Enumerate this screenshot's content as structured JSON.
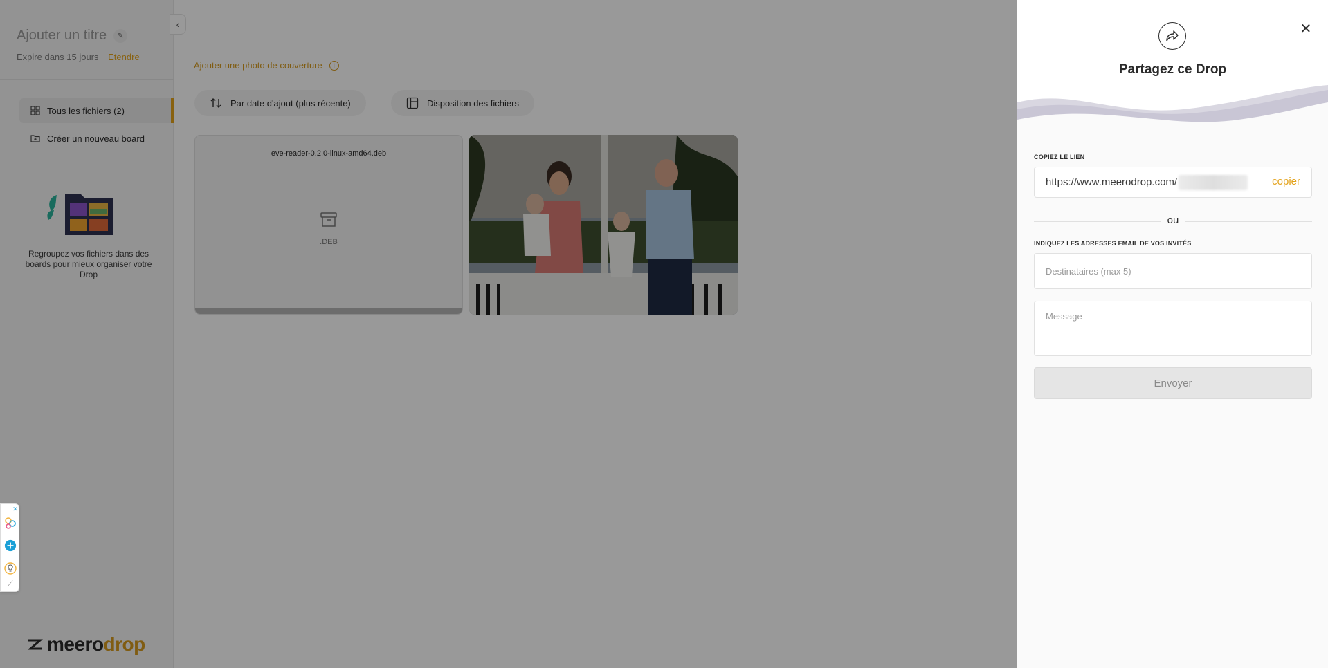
{
  "sidebar": {
    "title": "Ajouter un titre",
    "expire_text": "Expire dans 15 jours",
    "extend_label": "Etendre",
    "nav": [
      {
        "label": "Tous les fichiers (2)",
        "icon": "grid-icon"
      },
      {
        "label": "Créer un nouveau board",
        "icon": "folder-add-icon"
      }
    ],
    "board_text": "Regroupez vos fichiers dans des boards pour mieux organiser votre Drop",
    "logo": {
      "meero": "meero",
      "drop": "drop"
    }
  },
  "main": {
    "cover_link": "Ajouter une photo de couverture",
    "sort_label": "Par date d'ajout (plus récente)",
    "layout_label": "Disposition des fichiers",
    "files": [
      {
        "name": "eve-reader-0.2.0-linux-amd64.deb",
        "ext": ".DEB"
      }
    ]
  },
  "share_panel": {
    "title": "Partagez ce Drop",
    "copy_link_label": "COPIEZ LE LIEN",
    "link_url": "https://www.meerodrop.com/",
    "copy_label": "copier",
    "or_label": "ou",
    "email_label": "INDIQUEZ LES ADRESSES EMAIL DE VOS INVITÉS",
    "recipients_placeholder": "Destinataires (max 5)",
    "message_placeholder": "Message",
    "send_label": "Envoyer"
  },
  "colors": {
    "accent": "#e3a21a",
    "overlay": "rgba(0,0,0,0.4)",
    "panel_bg": "#fafafa"
  }
}
